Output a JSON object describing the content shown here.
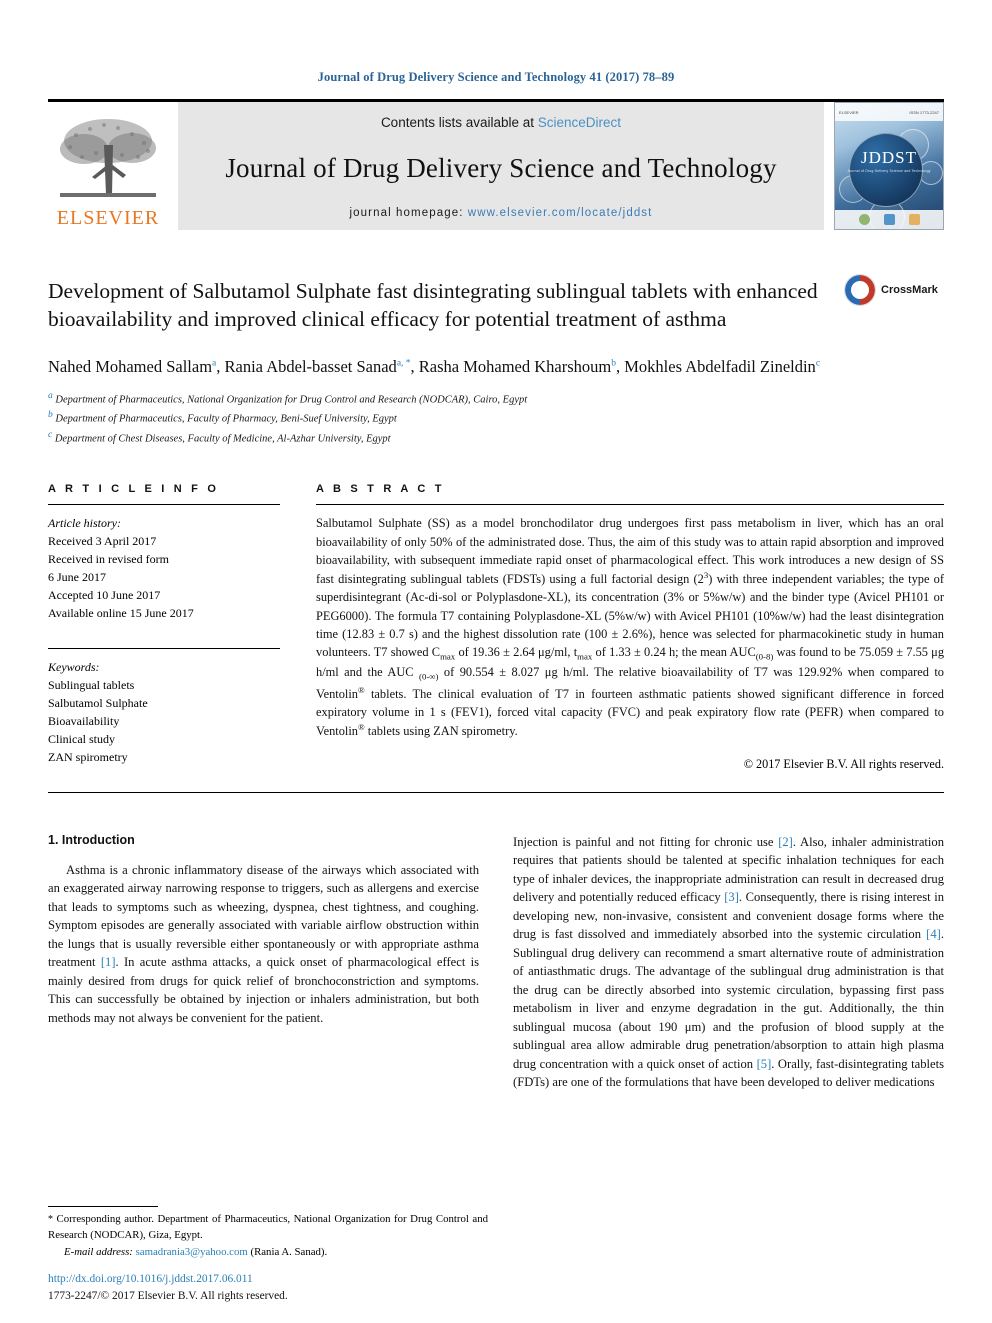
{
  "running_head": "Journal of Drug Delivery Science and Technology 41 (2017) 78–89",
  "masthead": {
    "publisher_name": "ELSEVIER",
    "contents_prefix": "Contents lists available at ",
    "contents_link": "ScienceDirect",
    "journal_title": "Journal of Drug Delivery Science and Technology",
    "homepage_prefix": "journal homepage: ",
    "homepage_url": "www.elsevier.com/locate/jddst",
    "cover_title": "JDDST",
    "cover_subtitle": "Journal of Drug Delivery Science and Technology",
    "cover_topbar_left": "ELSEVIER",
    "cover_topbar_right": "ISSN 1773-2247"
  },
  "article": {
    "title": "Development of Salbutamol Sulphate fast disintegrating sublingual tablets with enhanced bioavailability and improved clinical efficacy for potential treatment of asthma",
    "crossmark_label": "CrossMark",
    "authors": [
      {
        "name": "Nahed Mohamed Sallam",
        "marks": "a",
        "sep": ", "
      },
      {
        "name": "Rania Abdel-basset Sanad",
        "marks": "a, *",
        "sep": ", "
      },
      {
        "name": "Rasha Mohamed Kharshoum",
        "marks": "b",
        "sep": ", "
      },
      {
        "name": "Mokhles Abdelfadil Zineldin",
        "marks": "c",
        "sep": ""
      }
    ],
    "affiliations": [
      {
        "mark": "a",
        "text": "Department of Pharmaceutics, National Organization for Drug Control and Research (NODCAR), Cairo, Egypt"
      },
      {
        "mark": "b",
        "text": "Department of Pharmaceutics, Faculty of Pharmacy, Beni-Suef University, Egypt"
      },
      {
        "mark": "c",
        "text": "Department of Chest Diseases, Faculty of Medicine, Al-Azhar University, Egypt"
      }
    ]
  },
  "article_info": {
    "heading": "A R T I C L E   I N F O",
    "history_label": "Article history:",
    "history": [
      "Received 3 April 2017",
      "Received in revised form",
      "6 June 2017",
      "Accepted 10 June 2017",
      "Available online 15 June 2017"
    ],
    "keywords_label": "Keywords:",
    "keywords": [
      "Sublingual tablets",
      "Salbutamol Sulphate",
      "Bioavailability",
      "Clinical study",
      "ZAN spirometry"
    ]
  },
  "abstract": {
    "heading": "A B S T R A C T",
    "p1": "Salbutamol Sulphate (SS) as a model bronchodilator drug undergoes first pass metabolism in liver, which has an oral bioavailability of only 50% of the administrated dose. Thus, the aim of this study was to attain rapid absorption and improved bioavailability, with subsequent immediate rapid onset of pharmacological effect. This work introduces a new design of SS fast disintegrating sublingual tablets (FDSTs) using a full factorial design (2",
    "p1_sup": "3",
    "p2": ") with three independent variables; the type of superdisintegrant (Ac-di-sol or Polyplasdone-XL), its concentration (3% or 5%w/w) and the binder type (Avicel PH101 or PEG6000). The formula T7 containing Polyplasdone-XL (5%w/w) with Avicel PH101 (10%w/w) had the least disintegration time (12.83 ± 0.7 s) and the highest dissolution rate (100 ± 2.6%), hence was selected for pharmacokinetic study in human volunteers. T7 showed C",
    "sub_cmax": "max",
    "p3": " of 19.36 ± 2.64 μg/ml, t",
    "sub_tmax": "max",
    "p4": " of 1.33 ± 0.24 h; the mean AUC",
    "sub_auc1": "(0-8)",
    "p5": " was found to be 75.059 ± 7.55 μg h/ml and the AUC ",
    "sub_auc2": "(0-∞)",
    "p6": " of 90.554 ± 8.027 μg h/ml. The relative bioavailability of T7 was 129.92% when compared to Ventolin",
    "sup_reg1": "®",
    "p7": " tablets. The clinical evaluation of T7 in fourteen asthmatic patients showed significant difference in forced expiratory volume in 1 s (FEV1), forced vital capacity (FVC) and peak expiratory flow rate (PEFR) when compared to Ventolin",
    "sup_reg2": "®",
    "p8": " tablets using ZAN spirometry.",
    "copyright": "© 2017 Elsevier B.V. All rights reserved."
  },
  "introduction": {
    "section_number_title": "1. Introduction",
    "left_p1_a": "Asthma is a chronic inflammatory disease of the airways which associated with an exaggerated airway narrowing response to triggers, such as allergens and exercise that leads to symptoms such as wheezing, dyspnea, chest tightness, and coughing. Symptom episodes are generally associated with variable airflow obstruction within the lungs that is usually reversible either spontaneously or with appropriate asthma treatment ",
    "left_ref1": "[1]",
    "left_p1_b": ". In acute asthma attacks, a quick onset of pharmacological effect is mainly desired from drugs for quick relief of bronchoconstriction and symptoms. This can successfully be obtained by injection or inhalers administration, but both methods may not always be convenient for the patient.",
    "right_p1_a": "Injection is painful and not fitting for chronic use ",
    "right_ref2": "[2]",
    "right_p1_b": ". Also, inhaler administration requires that patients should be talented at specific inhalation techniques for each type of inhaler devices, the inappropriate administration can result in decreased drug delivery and potentially reduced efficacy ",
    "right_ref3": "[3]",
    "right_p1_c": ". Consequently, there is rising interest in developing new, non-invasive, consistent and convenient dosage forms where the drug is fast dissolved and immediately absorbed into the systemic circulation ",
    "right_ref4": "[4]",
    "right_p1_d": ". Sublingual drug delivery can recommend a smart alternative route of administration of antiasthmatic drugs. The advantage of the sublingual drug administration is that the drug can be directly absorbed into systemic circulation, bypassing first pass metabolism in liver and enzyme degradation in the gut. Additionally, the thin sublingual mucosa (about 190 μm) and the profusion of blood supply at the sublingual area allow admirable drug penetration/absorption to attain high plasma drug concentration with a quick onset of action ",
    "right_ref5": "[5]",
    "right_p1_e": ". Orally, fast-disintegrating tablets (FDTs) are one of the formulations that have been developed to deliver medications"
  },
  "footer": {
    "star": "*",
    "corresponding": " Corresponding author. Department of Pharmaceutics, National Organization for Drug Control and Research (NODCAR), Giza, Egypt.",
    "email_label": "E-mail address:",
    "email": "samadrania3@yahoo.com",
    "email_owner": "(Rania A. Sanad).",
    "doi": "http://dx.doi.org/10.1016/j.jddst.2017.06.011",
    "issn_line": "1773-2247/© 2017 Elsevier B.V. All rights reserved."
  },
  "colors": {
    "link": "#2a7fb8",
    "running_head": "#2a6496",
    "elsevier_orange": "#E87722",
    "masthead_grey": "#e6e6e6"
  }
}
